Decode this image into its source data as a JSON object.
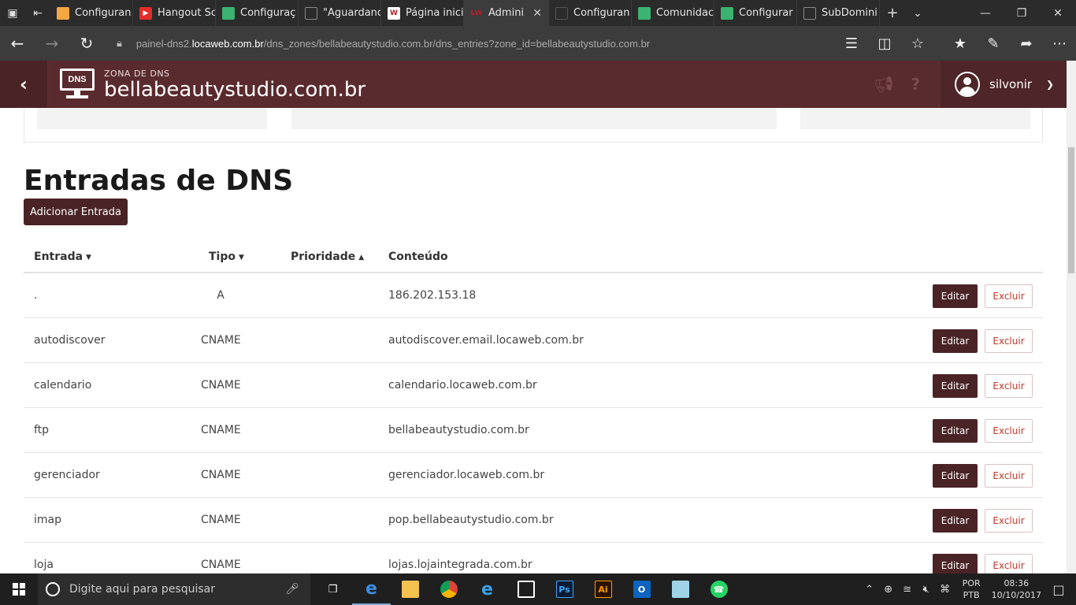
{
  "browser": {
    "tabs": [
      {
        "label": "Configuran",
        "fav": "cube",
        "color": "#f4a742"
      },
      {
        "label": "Hangout Sc",
        "fav": "youtube",
        "color": "#e52d27"
      },
      {
        "label": "Configuraç",
        "fav": "cube",
        "color": "#3cb371"
      },
      {
        "label": "\"Aguardano",
        "fav": "page",
        "color": "#888888"
      },
      {
        "label": "Página inici",
        "fav": "W",
        "color": "#ffffff"
      },
      {
        "label": "Admini",
        "fav": "LW",
        "color": "#b0212b",
        "active": true
      },
      {
        "label": "Configuran",
        "fav": "page-dark",
        "color": "#555555"
      },
      {
        "label": "Comunidac",
        "fav": "cube",
        "color": "#3cb371"
      },
      {
        "label": "Configurar",
        "fav": "cube",
        "color": "#3cb371"
      },
      {
        "label": "SubDomini",
        "fav": "page",
        "color": "#888888"
      }
    ],
    "url_prefix": "painel-dns2.",
    "url_domain": "locaweb.com.br",
    "url_path": "/dns_zones/bellabeautystudio.com.br/dns_entries?zone_id=bellabeautystudio.com.br"
  },
  "header": {
    "logo_text": "DNS",
    "zone_label": "ZONA DE DNS",
    "zone_name": "bellabeautystudio.com.br",
    "user_name": "silvonir"
  },
  "main": {
    "title": "Entradas de DNS",
    "add_button": "Adicionar Entrada",
    "columns": {
      "entrada": "Entrada",
      "tipo": "Tipo",
      "prioridade": "Prioridade",
      "conteudo": "Conteúdo"
    },
    "edit_label": "Editar",
    "delete_label": "Excluir",
    "rows": [
      {
        "entrada": ".",
        "tipo": "A",
        "prioridade": "",
        "conteudo": "186.202.153.18"
      },
      {
        "entrada": "autodiscover",
        "tipo": "CNAME",
        "prioridade": "",
        "conteudo": "autodiscover.email.locaweb.com.br"
      },
      {
        "entrada": "calendario",
        "tipo": "CNAME",
        "prioridade": "",
        "conteudo": "calendario.locaweb.com.br"
      },
      {
        "entrada": "ftp",
        "tipo": "CNAME",
        "prioridade": "",
        "conteudo": "bellabeautystudio.com.br"
      },
      {
        "entrada": "gerenciador",
        "tipo": "CNAME",
        "prioridade": "",
        "conteudo": "gerenciador.locaweb.com.br"
      },
      {
        "entrada": "imap",
        "tipo": "CNAME",
        "prioridade": "",
        "conteudo": "pop.bellabeautystudio.com.br"
      },
      {
        "entrada": "loja",
        "tipo": "CNAME",
        "prioridade": "",
        "conteudo": "lojas.lojaintegrada.com.br"
      }
    ]
  },
  "taskbar": {
    "search_placeholder": "Digite aqui para pesquisar",
    "lang_top": "POR",
    "lang_bottom": "PTB",
    "time": "08:36",
    "date": "10/10/2017"
  }
}
